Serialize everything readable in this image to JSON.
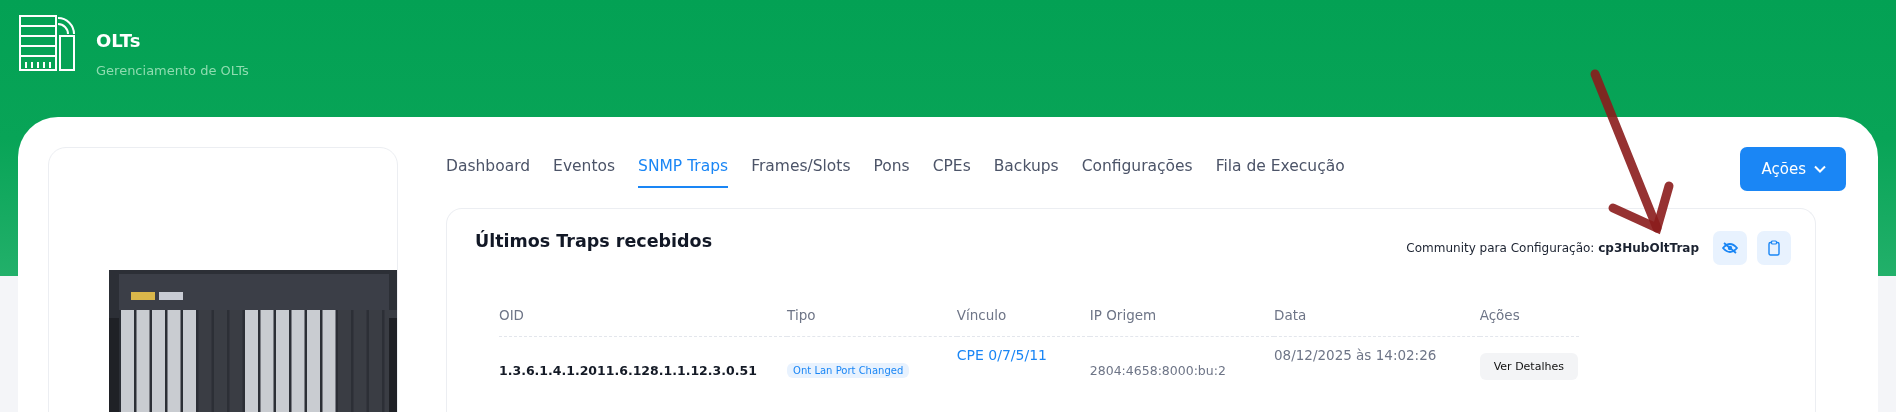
{
  "header": {
    "title": "OLTs",
    "subtitle": "Gerenciamento de OLTs"
  },
  "tabs": [
    {
      "label": "Dashboard",
      "selected": false
    },
    {
      "label": "Eventos",
      "selected": false
    },
    {
      "label": "SNMP Traps",
      "selected": true
    },
    {
      "label": "Frames/Slots",
      "selected": false
    },
    {
      "label": "Pons",
      "selected": false
    },
    {
      "label": "CPEs",
      "selected": false
    },
    {
      "label": "Backups",
      "selected": false
    },
    {
      "label": "Configurações",
      "selected": false
    },
    {
      "label": "Fila de Execução",
      "selected": false
    }
  ],
  "actions_button": "Ações",
  "panel": {
    "title": "Últimos Traps recebidos",
    "community_label": "Community para Configuração:",
    "community_value": "cp3HubOltTrap"
  },
  "table": {
    "columns": [
      "OID",
      "Tipo",
      "Vínculo",
      "IP Origem",
      "Data",
      "Ações"
    ],
    "rows": [
      {
        "oid": "1.3.6.1.4.1.2011.6.128.1.1.12.3.0.51",
        "tipo": "Ont Lan Port Changed",
        "vinculo": "CPE 0/7/5/11",
        "ip": "2804:4658:8000:bu:2",
        "data": "08/12/2025 às 14:02:26",
        "action": "Ver Detalhes"
      }
    ]
  }
}
